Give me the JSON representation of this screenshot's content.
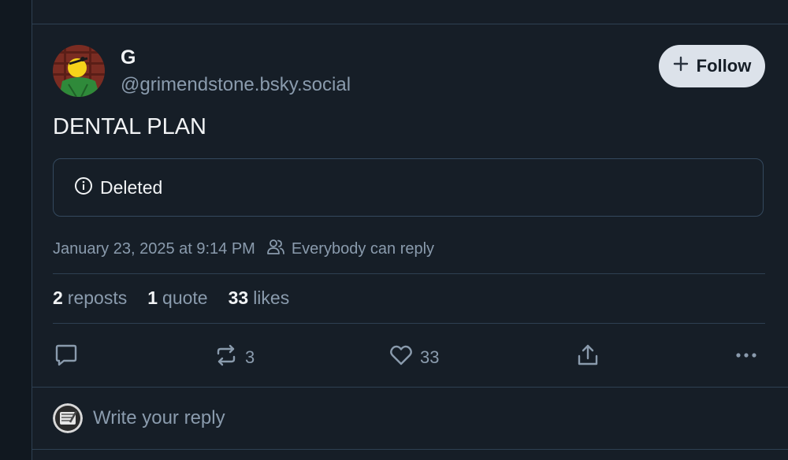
{
  "post": {
    "author": {
      "display_name": "G",
      "handle": "@grimendstone.bsky.social"
    },
    "follow_label": "Follow",
    "text": "DENTAL PLAN",
    "embed": {
      "label": "Deleted"
    },
    "timestamp": "January 23, 2025 at 9:14 PM",
    "reply_setting": "Everybody can reply",
    "stats": {
      "reposts_count": "2",
      "reposts_label": "reposts",
      "quotes_count": "1",
      "quotes_label": "quote",
      "likes_count": "33",
      "likes_label": "likes"
    },
    "actions": {
      "reply_icon": "speech-bubble-icon",
      "repost_icon": "repost-arrows-icon",
      "repost_count": "3",
      "like_icon": "heart-icon",
      "like_count": "33",
      "share_icon": "share-icon",
      "more_icon": "ellipsis-icon"
    }
  },
  "reply_composer": {
    "placeholder": "Write your reply"
  },
  "colors": {
    "background": "#161e27",
    "border": "#2e4052",
    "muted_text": "#8a9bad",
    "primary_text": "#f1f3f5",
    "follow_button_bg": "#dce2ea"
  }
}
